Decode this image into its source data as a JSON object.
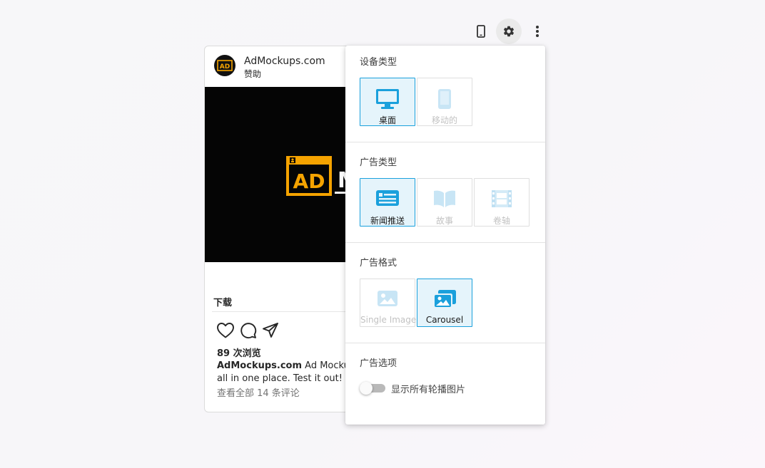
{
  "toolbar": {
    "icons": [
      "phone-icon",
      "gear-icon",
      "more-vert-icon"
    ]
  },
  "post": {
    "account_name": "AdMockups.com",
    "sponsored_label": "赞助",
    "media_logo_text": "AD",
    "cta_label": "下载",
    "views": "89 次浏览",
    "caption_account": "AdMockups.com",
    "caption_text_line1": "Ad Mockups",
    "caption_text_line2": "all in one place. Test it out!",
    "comments_link": "查看全部 14 条评论"
  },
  "settings": {
    "device_section": {
      "title": "设备类型",
      "options": [
        {
          "label": "桌面",
          "selected": true,
          "icon": "desktop-icon"
        },
        {
          "label": "移动的",
          "selected": false,
          "icon": "mobile-icon"
        }
      ]
    },
    "ad_type_section": {
      "title": "广告类型",
      "options": [
        {
          "label": "新闻推送",
          "selected": true,
          "icon": "newsfeed-icon"
        },
        {
          "label": "故事",
          "selected": false,
          "icon": "story-icon"
        },
        {
          "label": "卷轴",
          "selected": false,
          "icon": "reels-icon"
        }
      ]
    },
    "ad_format_section": {
      "title": "广告格式",
      "options": [
        {
          "label": "Single Image",
          "selected": false,
          "icon": "single-image-icon"
        },
        {
          "label": "Carousel",
          "selected": true,
          "icon": "carousel-icon"
        }
      ]
    },
    "ad_options_section": {
      "title": "广告选项",
      "toggle_label": "显示所有轮播图片",
      "toggle_on": false
    }
  },
  "colors": {
    "accent": "#1aa0dc",
    "selected_bg": "#e5f4fb",
    "logo_orange": "#f5a300"
  }
}
